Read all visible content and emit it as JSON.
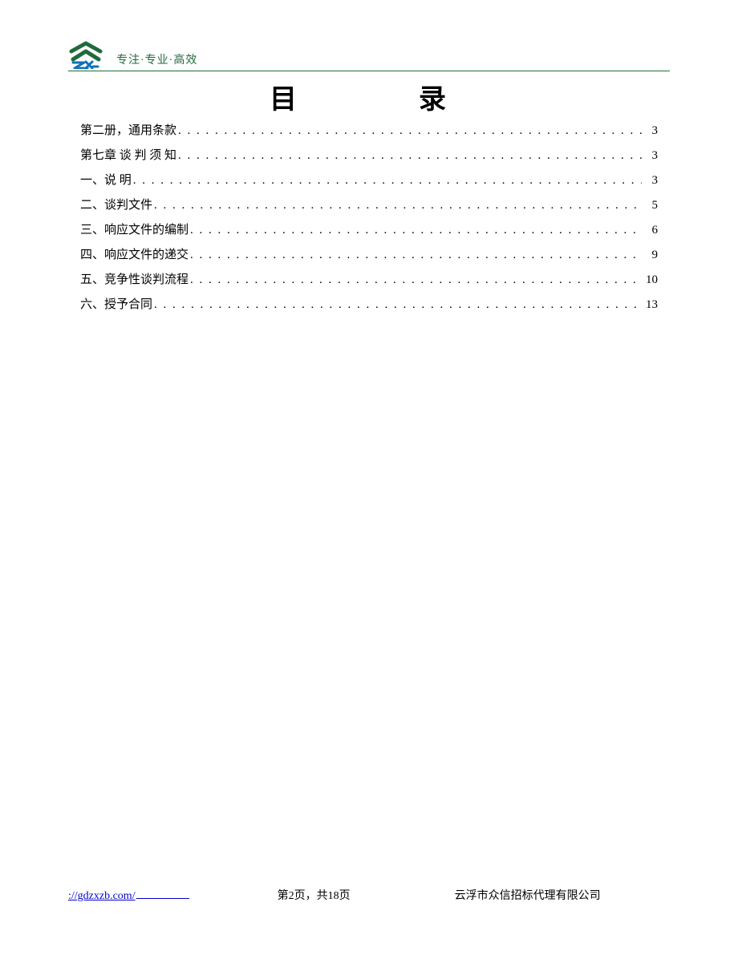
{
  "header": {
    "tagline": "专注·专业·高效",
    "logo_name": "zx-logo"
  },
  "title": "目　　录",
  "toc": {
    "items": [
      {
        "label": "第二册，通用条款",
        "page": "3"
      },
      {
        "label": "第七章 谈 判 须 知",
        "page": "3"
      },
      {
        "label": "一、说 明",
        "page": "3"
      },
      {
        "label": "二、谈判文件",
        "page": "5"
      },
      {
        "label": "三、响应文件的编制",
        "page": "6"
      },
      {
        "label": "四、响应文件的递交",
        "page": "9"
      },
      {
        "label": "五、竞争性谈判流程",
        "page": "10"
      },
      {
        "label": "六、授予合同",
        "page": "13"
      }
    ]
  },
  "footer": {
    "link_text": "://gdzxzb.com/",
    "page_indicator": "第2页，共18页",
    "company": "云浮市众信招标代理有限公司"
  },
  "colors": {
    "brand_green": "#1f6b3a",
    "brand_blue": "#1070b8",
    "link_blue": "#0000cc"
  }
}
